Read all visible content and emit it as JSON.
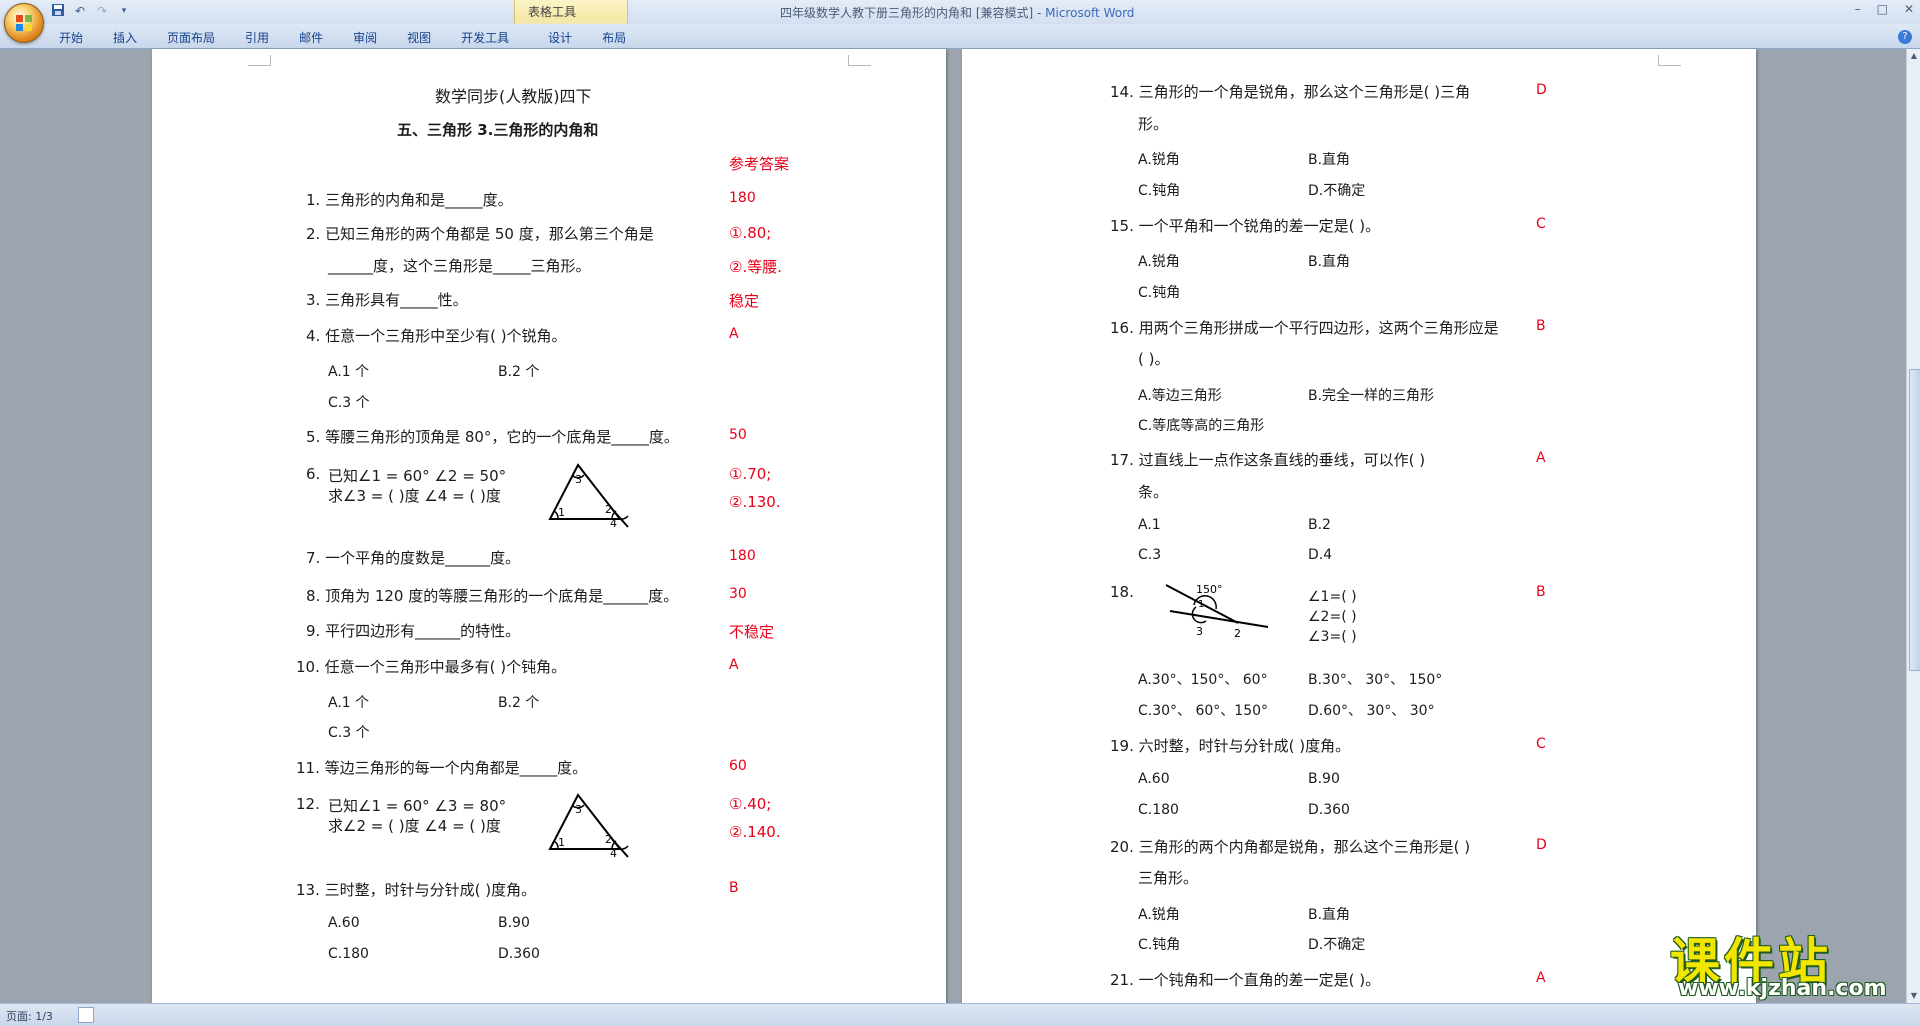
{
  "window": {
    "title": "四年级数学人教下册三角形的内角和 [兼容模式] - ",
    "app_name": "Microsoft Word",
    "context_tab": "表格工具",
    "controls": [
      "–",
      "□",
      "✕"
    ]
  },
  "ribbon": {
    "tabs": [
      "开始",
      "插入",
      "页面布局",
      "引用",
      "邮件",
      "审阅",
      "视图",
      "开发工具",
      "设计",
      "布局"
    ],
    "help": "?"
  },
  "page1": {
    "header_title": "数学同步(人教版)四下",
    "section_title": "五、三角形    3.三角形的内角和",
    "answer_heading": "参考答案",
    "q1": "1.  三角形的内角和是_____度。",
    "a1": "180",
    "q2a": "2.  已知三角形的两个角都是 50 度，那么第三个角是",
    "q2b": "______度，这个三角形是_____三角形。",
    "a2a": "①.80;",
    "a2b": "②.等腰.",
    "q3": "3.  三角形具有_____性。",
    "a3": "稳定",
    "q4": "4.  任意一个三角形中至少有(        )个锐角。",
    "a4": "A",
    "q4_optA": "A.1 个",
    "q4_optB": "B.2 个",
    "q4_optC": "C.3 个",
    "q5": "5.  等腰三角形的顶角是 80°，它的一个底角是_____度。",
    "a5": "50",
    "q6_num": "6.",
    "q6_l1": "已知∠1 = 60°    ∠2 = 50°",
    "q6_l2": "求∠3 = (    )度    ∠4 = (    )度",
    "a6a": "①.70;",
    "a6b": "②.130.",
    "q7": "7.  一个平角的度数是______度。",
    "a7": "180",
    "q8": "8.  顶角为 120 度的等腰三角形的一个底角是______度。",
    "a8": "30",
    "q9": "9.  平行四边形有______的特性。",
    "a9": "不稳定",
    "q10": "10. 任意一个三角形中最多有(        )个钝角。",
    "a10": "A",
    "q10_optA": "A.1 个",
    "q10_optB": "B.2 个",
    "q10_optC": "C.3 个",
    "q11": "11. 等边三角形的每一个内角都是_____度。",
    "a11": "60",
    "q12_num": "12.",
    "q12_l1": "已知∠1 = 60°    ∠3 = 80°",
    "q12_l2": "求∠2 = (    )度    ∠4 = (    )度",
    "a12a": "①.40;",
    "a12b": "②.140.",
    "q13": "13. 三时整，时针与分针成(     )度角。",
    "a13": "B",
    "q13_optA": "A.60",
    "q13_optB": "B.90",
    "q13_optC": "C.180",
    "q13_optD": "D.360",
    "tri_labels": [
      "3",
      "1",
      "2",
      "4"
    ]
  },
  "page2": {
    "q14a": "14. 三角形的一个角是锐角，那么这个三角形是(      )三角",
    "q14b": "形。",
    "a14": "D",
    "q14_optA": "A.锐角",
    "q14_optB": "B.直角",
    "q14_optC": "C.钝角",
    "q14_optD": "D.不确定",
    "q15": "15. 一个平角和一个锐角的差一定是(              )。",
    "a15": "C",
    "q15_optA": "A.锐角",
    "q15_optB": "B.直角",
    "q15_optC": "C.钝角",
    "q16a": "16. 用两个三角形拼成一个平行四边形，这两个三角形应是",
    "q16b": "(         )。",
    "a16": "B",
    "q16_optA": "A.等边三角形",
    "q16_optB": "B.完全一样的三角形",
    "q16_optC": "C.等底等高的三角形",
    "q17a": "17. 过直线上一点作这条直线的垂线，可以作(          )",
    "q17b": "条。",
    "a17": "A",
    "q17_optA": "A.1",
    "q17_optB": "B.2",
    "q17_optC": "C.3",
    "q17_optD": "D.4",
    "q18_num": "18.",
    "q18_angle": "150°",
    "q18_l1": "∠1=(      )",
    "q18_l2": "∠2=(      )",
    "q18_l3": "∠3=(      )",
    "a18": "B",
    "q18_optA": "A.30°、150°、  60°",
    "q18_optB": "B.30°、  30°、  150°",
    "q18_optC": "C.30°、  60°、150°",
    "q18_optD": "D.60°、  30°、  30°",
    "q18_line_labels": [
      "1",
      "3",
      "2"
    ],
    "q19": "19. 六时整，时针与分针成(      )度角。",
    "a19": "C",
    "q19_optA": "A.60",
    "q19_optB": "B.90",
    "q19_optC": "C.180",
    "q19_optD": "D.360",
    "q20a": "20. 三角形的两个内角都是锐角，那么这个三角形是(      )",
    "q20b": "三角形。",
    "a20": "D",
    "q20_optA": "A.锐角",
    "q20_optB": "B.直角",
    "q20_optC": "C.钝角",
    "q20_optD": "D.不确定",
    "q21": "21. 一个钝角和一个直角的差一定是(              )。",
    "a21": "A"
  },
  "status": {
    "page": "页面: 1/3"
  },
  "watermark": {
    "main": "课件站",
    "url": "www.kjzhan.com"
  },
  "colors": {
    "answer": "#e8001a",
    "ribbon": "#c8d7eb"
  }
}
